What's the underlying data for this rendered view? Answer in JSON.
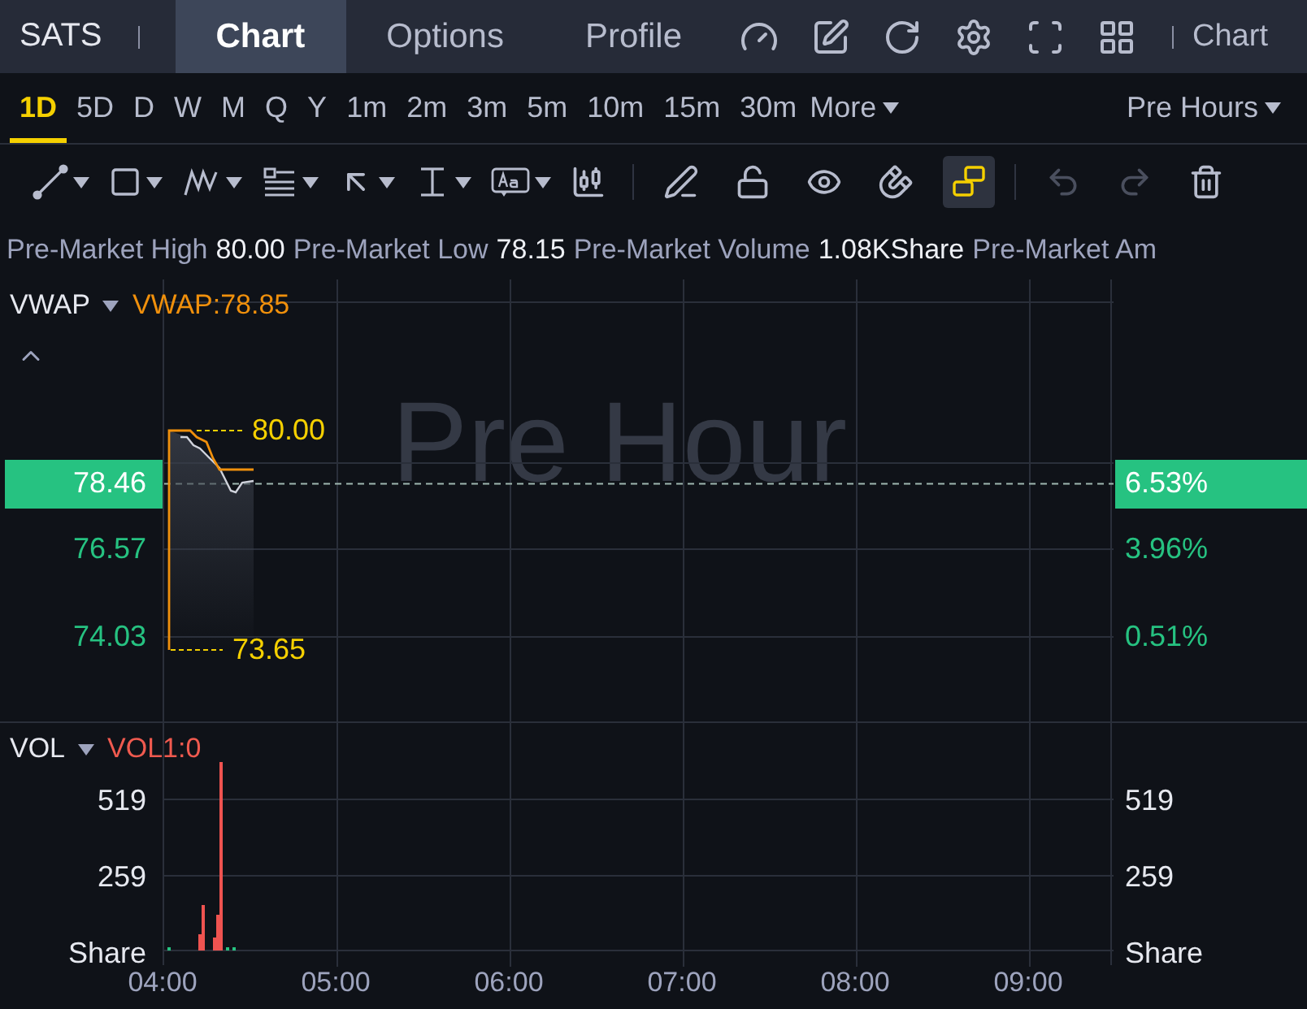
{
  "header": {
    "symbol": "SATS",
    "tabs": [
      {
        "label": "Chart",
        "selected": true
      },
      {
        "label": "Options",
        "selected": false
      },
      {
        "label": "Profile",
        "selected": false
      }
    ],
    "right_label": "Chart"
  },
  "periods": [
    {
      "label": "1D",
      "selected": true
    },
    {
      "label": "5D",
      "selected": false
    },
    {
      "label": "D",
      "selected": false
    },
    {
      "label": "W",
      "selected": false
    },
    {
      "label": "M",
      "selected": false
    },
    {
      "label": "Q",
      "selected": false
    },
    {
      "label": "Y",
      "selected": false
    },
    {
      "label": "1m",
      "selected": false
    },
    {
      "label": "2m",
      "selected": false
    },
    {
      "label": "3m",
      "selected": false
    },
    {
      "label": "5m",
      "selected": false
    },
    {
      "label": "10m",
      "selected": false
    },
    {
      "label": "15m",
      "selected": false
    },
    {
      "label": "30m",
      "selected": false
    }
  ],
  "more_label": "More",
  "session_menu": "Pre Hours",
  "drawing_toolbar": {
    "sync_on": true,
    "undo_enabled": false,
    "redo_enabled": false
  },
  "stats": [
    {
      "label": "Pre-Market High",
      "value": "80.00"
    },
    {
      "label": "Pre-Market Low",
      "value": "78.15"
    },
    {
      "label": "Pre-Market Volume",
      "value": "1.08KShare"
    },
    {
      "label": "Pre-Market Am"
    }
  ],
  "price_chart": {
    "indicator": "VWAP",
    "indicator_value": "VWAP:78.85",
    "session_label": "Pre Hour",
    "high_label": "80.00",
    "low_label": "73.65",
    "current_price": "78.46",
    "current_change": "6.53%",
    "price_labels": [
      "76.57",
      "74.03"
    ],
    "percent_labels": [
      "3.96%",
      "0.51%"
    ]
  },
  "volume_chart": {
    "indicator": "VOL",
    "indicator_value": "VOL1:0",
    "left_labels": [
      "519",
      "259",
      "Share"
    ],
    "right_labels": [
      "519",
      "259",
      "Share"
    ]
  },
  "time_axis": [
    "04:00",
    "05:00",
    "06:00",
    "07:00",
    "08:00",
    "09:00"
  ]
}
